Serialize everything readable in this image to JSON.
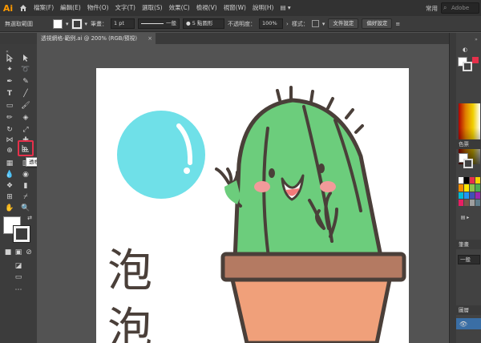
{
  "menubar": {
    "logo": "Ai",
    "items": [
      "檔案(F)",
      "編輯(E)",
      "物件(O)",
      "文字(T)",
      "選取(S)",
      "效果(C)",
      "檢視(V)",
      "視窗(W)",
      "說明(H)"
    ],
    "workspace": "常用",
    "search_placeholder": "Adobe"
  },
  "controlbar": {
    "selection_status": "無選取範圍",
    "stroke_label": "筆畫：",
    "stroke_weight": "1 pt",
    "line_style": "一般",
    "brush": "5 點圓形",
    "opacity_label": "不透明度：",
    "opacity_value": "100%",
    "style_label": "樣式：",
    "doc_setup_button": "文件設定",
    "preferences_button": "偏好設定"
  },
  "document_tab": {
    "title": "透視網格-範例.ai @ 200% (RGB/預視)",
    "close": "×"
  },
  "tooltip": {
    "text": "透視格點工具 (Shift+P)"
  },
  "artwork": {
    "vertical_text": [
      "泡",
      "泡"
    ]
  },
  "right_panel": {
    "color_panel": "色票",
    "stroke_panel": "筆畫",
    "appearance_dropdown": "一般",
    "layers_panel": "圖層"
  },
  "colors": {
    "bubble": "#6fe0e8",
    "cactus": "#6ccd7c",
    "pot_rim": "#b47a62",
    "pot_body": "#f0a07a",
    "outline": "#4a3f39",
    "highlight_red": "#e6304b"
  }
}
